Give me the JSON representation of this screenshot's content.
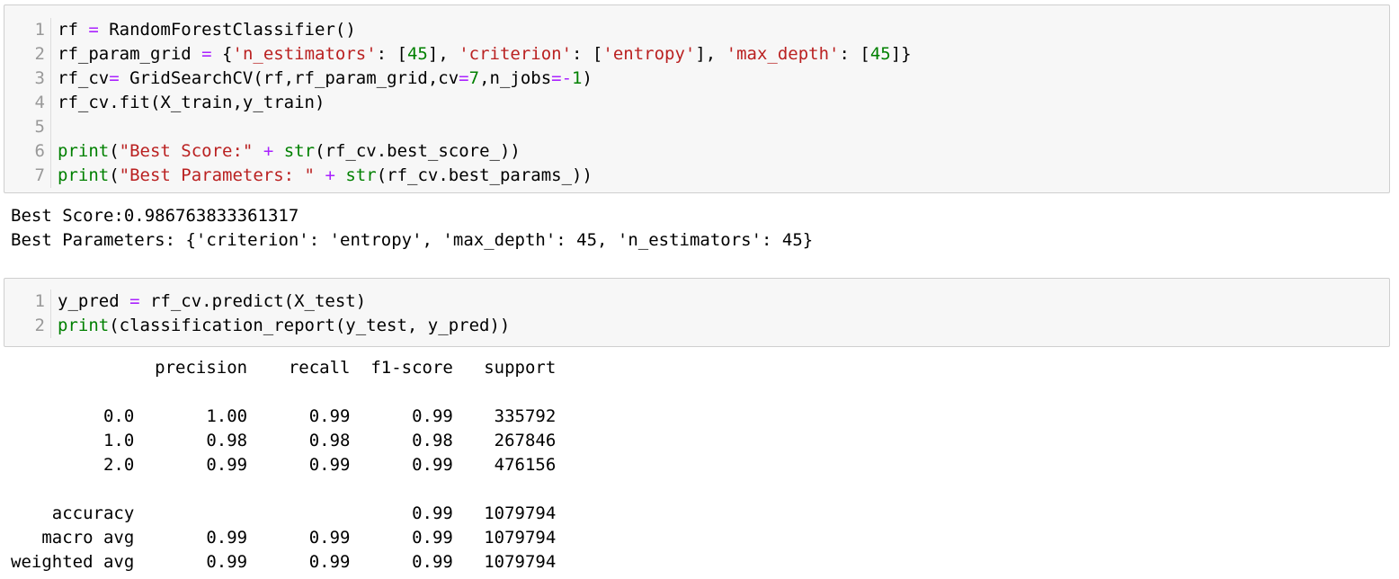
{
  "cells": [
    {
      "lines": [
        {
          "num": "1",
          "tokens": [
            {
              "t": "rf ",
              "c": ""
            },
            {
              "t": "=",
              "c": "op"
            },
            {
              "t": " RandomForestClassifier()",
              "c": ""
            }
          ]
        },
        {
          "num": "2",
          "tokens": [
            {
              "t": "rf_param_grid ",
              "c": ""
            },
            {
              "t": "=",
              "c": "op"
            },
            {
              "t": " {",
              "c": ""
            },
            {
              "t": "'n_estimators'",
              "c": "str"
            },
            {
              "t": ": [",
              "c": ""
            },
            {
              "t": "45",
              "c": "num"
            },
            {
              "t": "], ",
              "c": ""
            },
            {
              "t": "'criterion'",
              "c": "str"
            },
            {
              "t": ": [",
              "c": ""
            },
            {
              "t": "'entropy'",
              "c": "str"
            },
            {
              "t": "], ",
              "c": ""
            },
            {
              "t": "'max_depth'",
              "c": "str"
            },
            {
              "t": ": [",
              "c": ""
            },
            {
              "t": "45",
              "c": "num"
            },
            {
              "t": "]}",
              "c": ""
            }
          ]
        },
        {
          "num": "3",
          "tokens": [
            {
              "t": "rf_cv",
              "c": ""
            },
            {
              "t": "=",
              "c": "op"
            },
            {
              "t": " GridSearchCV(rf,rf_param_grid,cv",
              "c": ""
            },
            {
              "t": "=",
              "c": "op"
            },
            {
              "t": "7",
              "c": "num"
            },
            {
              "t": ",n_jobs",
              "c": ""
            },
            {
              "t": "=-",
              "c": "op"
            },
            {
              "t": "1",
              "c": "num"
            },
            {
              "t": ")",
              "c": ""
            }
          ]
        },
        {
          "num": "4",
          "tokens": [
            {
              "t": "rf_cv.fit(X_train,y_train)",
              "c": ""
            }
          ]
        },
        {
          "num": "5",
          "tokens": []
        },
        {
          "num": "6",
          "tokens": [
            {
              "t": "print",
              "c": "kw"
            },
            {
              "t": "(",
              "c": ""
            },
            {
              "t": "\"Best Score:\"",
              "c": "str"
            },
            {
              "t": " ",
              "c": ""
            },
            {
              "t": "+",
              "c": "op"
            },
            {
              "t": " ",
              "c": ""
            },
            {
              "t": "str",
              "c": "kw"
            },
            {
              "t": "(rf_cv.best_score_))",
              "c": ""
            }
          ]
        },
        {
          "num": "7",
          "tokens": [
            {
              "t": "print",
              "c": "kw"
            },
            {
              "t": "(",
              "c": ""
            },
            {
              "t": "\"Best Parameters: \"",
              "c": "str"
            },
            {
              "t": " ",
              "c": ""
            },
            {
              "t": "+",
              "c": "op"
            },
            {
              "t": " ",
              "c": ""
            },
            {
              "t": "str",
              "c": "kw"
            },
            {
              "t": "(rf_cv.best_params_))",
              "c": ""
            }
          ]
        }
      ]
    },
    {
      "lines": [
        {
          "num": "1",
          "tokens": [
            {
              "t": "y_pred ",
              "c": ""
            },
            {
              "t": "=",
              "c": "op"
            },
            {
              "t": " rf_cv.predict(X_test)",
              "c": ""
            }
          ]
        },
        {
          "num": "2",
          "tokens": [
            {
              "t": "print",
              "c": "kw"
            },
            {
              "t": "(classification_report(y_test, y_pred))",
              "c": ""
            }
          ]
        }
      ]
    }
  ],
  "outputs": [
    {
      "lines": [
        "Best Score:0.986763833361317",
        "Best Parameters: {'criterion': 'entropy', 'max_depth': 45, 'n_estimators': 45}"
      ]
    },
    {
      "lines": [
        "              precision    recall  f1-score   support",
        "",
        "         0.0       1.00      0.99      0.99    335792",
        "         1.0       0.98      0.98      0.98    267846",
        "         2.0       0.99      0.99      0.99    476156",
        "",
        "    accuracy                           0.99   1079794",
        "   macro avg       0.99      0.99      0.99   1079794",
        "weighted avg       0.99      0.99      0.99   1079794"
      ]
    }
  ]
}
